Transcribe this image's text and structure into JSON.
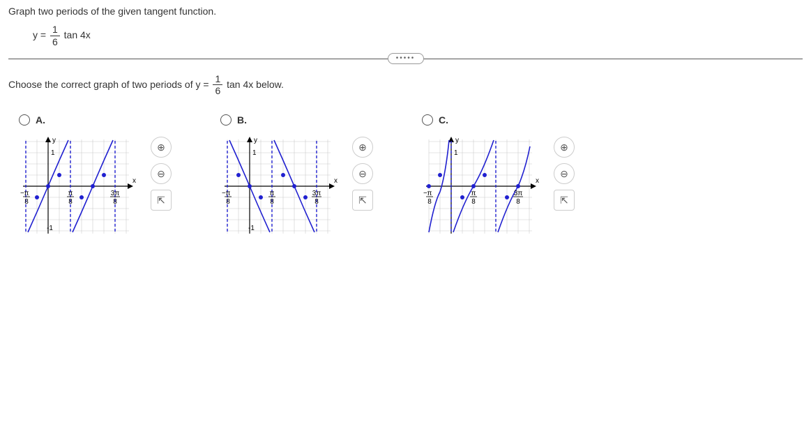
{
  "question": {
    "text": "Graph two periods of the given tangent function.",
    "eq_prefix": "y = ",
    "eq_numerator": "1",
    "eq_denominator": "6",
    "eq_suffix": " tan 4x"
  },
  "instruction": {
    "prefix": "Choose the correct graph of two periods of y = ",
    "numerator": "1",
    "denominator": "6",
    "suffix": " tan 4x below."
  },
  "options": {
    "a": {
      "label": "A."
    },
    "b": {
      "label": "B."
    },
    "c": {
      "label": "C."
    }
  },
  "axis_labels": {
    "y": "y",
    "x": "x",
    "y_top": "1",
    "y_bottom": "-1",
    "x_left_num": "π",
    "x_left_den": "8",
    "x_mid_num": "π",
    "x_mid_den": "8",
    "x_right_num": "3π",
    "x_right_den": "8",
    "neg": "−"
  },
  "tools": {
    "zoom_in": "⊕",
    "zoom_out": "⊖",
    "popout": "⇱"
  },
  "chart_data": [
    {
      "option": "A",
      "type": "line",
      "function": "y = (1/6) tan(4x)",
      "behavior": "increasing tangent",
      "period": "π/4",
      "asymptotes_x": [
        "-π/8",
        "π/8",
        "3π/8"
      ],
      "zeros_x": [
        "0",
        "π/4"
      ],
      "y_range": [
        -1,
        1
      ],
      "x_range": [
        "-π/8",
        "3π/8"
      ],
      "xlabel": "x",
      "ylabel": "y"
    },
    {
      "option": "B",
      "type": "line",
      "function": "y = -(1/6) tan(4x)",
      "behavior": "decreasing tangent",
      "period": "π/4",
      "asymptotes_x": [
        "-π/8",
        "π/8",
        "3π/8"
      ],
      "zeros_x": [
        "0",
        "π/4"
      ],
      "y_range": [
        -1,
        1
      ],
      "x_range": [
        "-π/8",
        "3π/8"
      ],
      "xlabel": "x",
      "ylabel": "y"
    },
    {
      "option": "C",
      "type": "line",
      "function": "y = (1/6) tan(4x) reflected/cot-like",
      "behavior": "decreasing-then-increasing, asymptote at 0 and π/4",
      "period": "π/4",
      "asymptotes_x": [
        "0",
        "π/4"
      ],
      "zeros_x": [
        "-π/8",
        "π/8",
        "3π/8"
      ],
      "y_range": [
        -1,
        1
      ],
      "x_range": [
        "-π/8",
        "3π/8"
      ],
      "xlabel": "x",
      "ylabel": "y"
    }
  ]
}
